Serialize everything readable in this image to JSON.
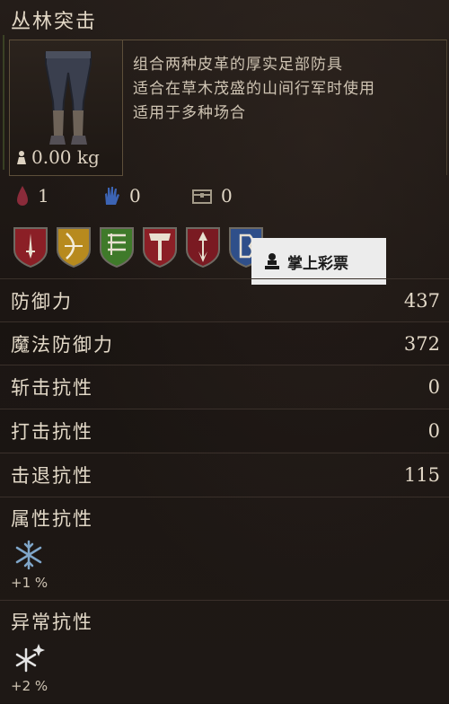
{
  "item": {
    "title": "丛林突击",
    "description": [
      "组合两种皮革的厚实足部防具",
      "适合在草木茂盛的山间行军时使用",
      "适用于多种场合"
    ],
    "weight": "0.00 kg"
  },
  "small_stats": [
    {
      "icon": "bleed-drop-icon",
      "value": "1"
    },
    {
      "icon": "blue-hand-icon",
      "value": "0"
    },
    {
      "icon": "chest-icon",
      "value": "0"
    }
  ],
  "affinity_icons": [
    "sword-shield-icon",
    "bow-shield-icon",
    "ladder-shield-icon",
    "axe-shield-icon",
    "spear-shield-icon",
    "blue-shield-icon"
  ],
  "watermark": {
    "text": "掌上彩票"
  },
  "stats": [
    {
      "label": "防御力",
      "value": "437"
    },
    {
      "label": "魔法防御力",
      "value": "372"
    },
    {
      "label": "斩击抗性",
      "value": "0"
    },
    {
      "label": "打击抗性",
      "value": "0"
    },
    {
      "label": "击退抗性",
      "value": "115"
    }
  ],
  "attribute_resist": {
    "label": "属性抗性",
    "icon": "snowflake-icon",
    "value": "+1 %"
  },
  "status_resist": {
    "label": "异常抗性",
    "icon": "frost-sparkle-icon",
    "value": "+2 %"
  },
  "colors": {
    "background": "#1c1613",
    "text": "#e2d8c7",
    "border": "#3a302a"
  }
}
